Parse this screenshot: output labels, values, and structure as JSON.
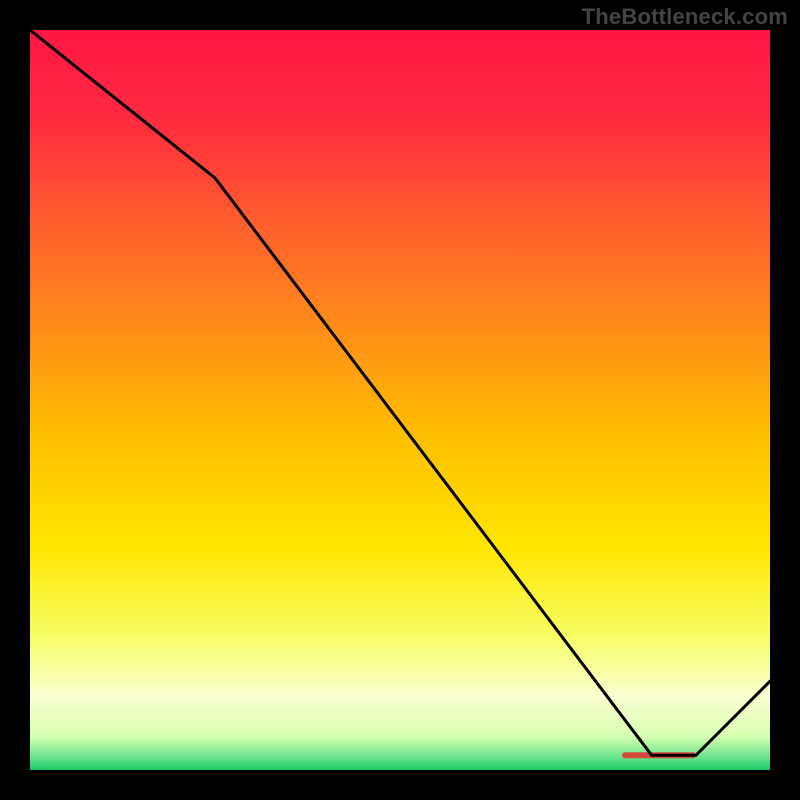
{
  "watermark": "TheBottleneck.com",
  "chart_data": {
    "type": "line",
    "title": "",
    "xlabel": "",
    "ylabel": "",
    "xlim": [
      0,
      100
    ],
    "ylim": [
      0,
      100
    ],
    "x": [
      0,
      25,
      84,
      90,
      100
    ],
    "values": [
      100,
      80,
      2,
      2,
      12
    ],
    "annotation_band": {
      "x_start": 80,
      "x_end": 90,
      "y": 2,
      "color": "#d44a3a"
    },
    "gradient_stops": [
      {
        "offset": 0.0,
        "color": "#ff1744"
      },
      {
        "offset": 0.12,
        "color": "#ff2a3f"
      },
      {
        "offset": 0.25,
        "color": "#ff5a2e"
      },
      {
        "offset": 0.4,
        "color": "#ff8c1a"
      },
      {
        "offset": 0.55,
        "color": "#ffbf00"
      },
      {
        "offset": 0.7,
        "color": "#ffe600"
      },
      {
        "offset": 0.82,
        "color": "#f7ff66"
      },
      {
        "offset": 0.9,
        "color": "#faffd0"
      },
      {
        "offset": 0.955,
        "color": "#d6ffb0"
      },
      {
        "offset": 0.985,
        "color": "#5fe08a"
      },
      {
        "offset": 1.0,
        "color": "#18c964"
      }
    ]
  }
}
